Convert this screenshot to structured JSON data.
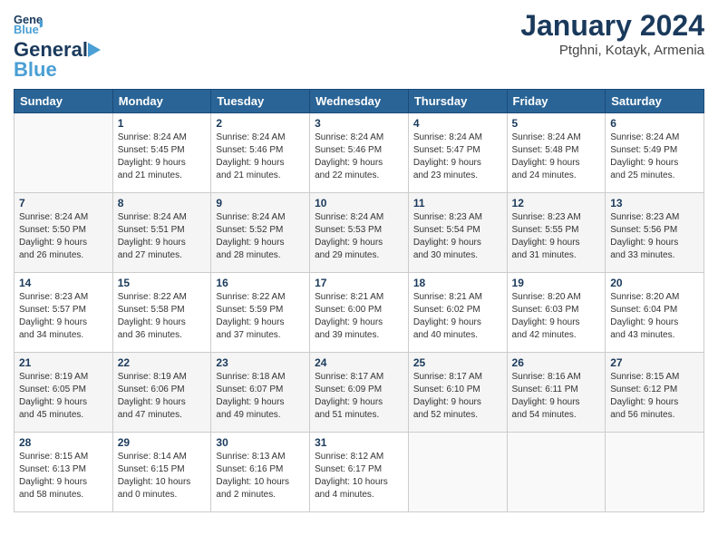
{
  "header": {
    "logo_general": "General",
    "logo_blue": "Blue",
    "month_title": "January 2024",
    "location": "Ptghni, Kotayk, Armenia"
  },
  "days_of_week": [
    "Sunday",
    "Monday",
    "Tuesday",
    "Wednesday",
    "Thursday",
    "Friday",
    "Saturday"
  ],
  "weeks": [
    [
      {
        "day": "",
        "info": ""
      },
      {
        "day": "1",
        "info": "Sunrise: 8:24 AM\nSunset: 5:45 PM\nDaylight: 9 hours\nand 21 minutes."
      },
      {
        "day": "2",
        "info": "Sunrise: 8:24 AM\nSunset: 5:46 PM\nDaylight: 9 hours\nand 21 minutes."
      },
      {
        "day": "3",
        "info": "Sunrise: 8:24 AM\nSunset: 5:46 PM\nDaylight: 9 hours\nand 22 minutes."
      },
      {
        "day": "4",
        "info": "Sunrise: 8:24 AM\nSunset: 5:47 PM\nDaylight: 9 hours\nand 23 minutes."
      },
      {
        "day": "5",
        "info": "Sunrise: 8:24 AM\nSunset: 5:48 PM\nDaylight: 9 hours\nand 24 minutes."
      },
      {
        "day": "6",
        "info": "Sunrise: 8:24 AM\nSunset: 5:49 PM\nDaylight: 9 hours\nand 25 minutes."
      }
    ],
    [
      {
        "day": "7",
        "info": "Sunrise: 8:24 AM\nSunset: 5:50 PM\nDaylight: 9 hours\nand 26 minutes."
      },
      {
        "day": "8",
        "info": "Sunrise: 8:24 AM\nSunset: 5:51 PM\nDaylight: 9 hours\nand 27 minutes."
      },
      {
        "day": "9",
        "info": "Sunrise: 8:24 AM\nSunset: 5:52 PM\nDaylight: 9 hours\nand 28 minutes."
      },
      {
        "day": "10",
        "info": "Sunrise: 8:24 AM\nSunset: 5:53 PM\nDaylight: 9 hours\nand 29 minutes."
      },
      {
        "day": "11",
        "info": "Sunrise: 8:23 AM\nSunset: 5:54 PM\nDaylight: 9 hours\nand 30 minutes."
      },
      {
        "day": "12",
        "info": "Sunrise: 8:23 AM\nSunset: 5:55 PM\nDaylight: 9 hours\nand 31 minutes."
      },
      {
        "day": "13",
        "info": "Sunrise: 8:23 AM\nSunset: 5:56 PM\nDaylight: 9 hours\nand 33 minutes."
      }
    ],
    [
      {
        "day": "14",
        "info": "Sunrise: 8:23 AM\nSunset: 5:57 PM\nDaylight: 9 hours\nand 34 minutes."
      },
      {
        "day": "15",
        "info": "Sunrise: 8:22 AM\nSunset: 5:58 PM\nDaylight: 9 hours\nand 36 minutes."
      },
      {
        "day": "16",
        "info": "Sunrise: 8:22 AM\nSunset: 5:59 PM\nDaylight: 9 hours\nand 37 minutes."
      },
      {
        "day": "17",
        "info": "Sunrise: 8:21 AM\nSunset: 6:00 PM\nDaylight: 9 hours\nand 39 minutes."
      },
      {
        "day": "18",
        "info": "Sunrise: 8:21 AM\nSunset: 6:02 PM\nDaylight: 9 hours\nand 40 minutes."
      },
      {
        "day": "19",
        "info": "Sunrise: 8:20 AM\nSunset: 6:03 PM\nDaylight: 9 hours\nand 42 minutes."
      },
      {
        "day": "20",
        "info": "Sunrise: 8:20 AM\nSunset: 6:04 PM\nDaylight: 9 hours\nand 43 minutes."
      }
    ],
    [
      {
        "day": "21",
        "info": "Sunrise: 8:19 AM\nSunset: 6:05 PM\nDaylight: 9 hours\nand 45 minutes."
      },
      {
        "day": "22",
        "info": "Sunrise: 8:19 AM\nSunset: 6:06 PM\nDaylight: 9 hours\nand 47 minutes."
      },
      {
        "day": "23",
        "info": "Sunrise: 8:18 AM\nSunset: 6:07 PM\nDaylight: 9 hours\nand 49 minutes."
      },
      {
        "day": "24",
        "info": "Sunrise: 8:17 AM\nSunset: 6:09 PM\nDaylight: 9 hours\nand 51 minutes."
      },
      {
        "day": "25",
        "info": "Sunrise: 8:17 AM\nSunset: 6:10 PM\nDaylight: 9 hours\nand 52 minutes."
      },
      {
        "day": "26",
        "info": "Sunrise: 8:16 AM\nSunset: 6:11 PM\nDaylight: 9 hours\nand 54 minutes."
      },
      {
        "day": "27",
        "info": "Sunrise: 8:15 AM\nSunset: 6:12 PM\nDaylight: 9 hours\nand 56 minutes."
      }
    ],
    [
      {
        "day": "28",
        "info": "Sunrise: 8:15 AM\nSunset: 6:13 PM\nDaylight: 9 hours\nand 58 minutes."
      },
      {
        "day": "29",
        "info": "Sunrise: 8:14 AM\nSunset: 6:15 PM\nDaylight: 10 hours\nand 0 minutes."
      },
      {
        "day": "30",
        "info": "Sunrise: 8:13 AM\nSunset: 6:16 PM\nDaylight: 10 hours\nand 2 minutes."
      },
      {
        "day": "31",
        "info": "Sunrise: 8:12 AM\nSunset: 6:17 PM\nDaylight: 10 hours\nand 4 minutes."
      },
      {
        "day": "",
        "info": ""
      },
      {
        "day": "",
        "info": ""
      },
      {
        "day": "",
        "info": ""
      }
    ]
  ]
}
